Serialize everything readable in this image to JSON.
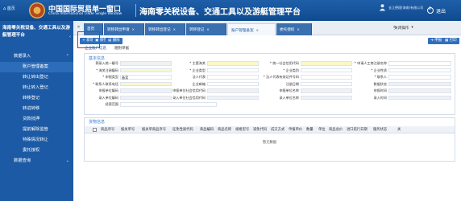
{
  "header": {
    "home_label": "首页",
    "brand_cn": "中国国际贸易单一窗口",
    "brand_en": "China International Trade Single Window",
    "title": "海南零关税设备、交通工具以及游艇管理平台",
    "user_text": "长江德理(海南)有限公司",
    "logout_label": "退出"
  },
  "sidebar": {
    "title": "海南零关税设备、交通工具以及游艇管理平台",
    "collapse_icon": "chevron-left-icon",
    "groups": [
      {
        "label": "数据录入",
        "expanded": true
      },
      {
        "label": "数据查询",
        "expanded": false
      }
    ],
    "items": [
      {
        "label": "账户管理备案",
        "active": true
      },
      {
        "label": "转让转出登记",
        "active": false
      },
      {
        "label": "转让转入登记",
        "active": false
      },
      {
        "label": "转移登记",
        "active": false
      },
      {
        "label": "转进转移",
        "active": false
      },
      {
        "label": "贷款抵押",
        "active": false
      },
      {
        "label": "提前解除监管",
        "active": false
      },
      {
        "label": "特殊情况转让",
        "active": false
      },
      {
        "label": "委托授权",
        "active": false
      }
    ]
  },
  "tabs": {
    "items": [
      {
        "label": "首页",
        "active": false
      },
      {
        "label": "转移转出申请",
        "active": false
      },
      {
        "label": "转移转出登记",
        "active": false
      },
      {
        "label": "转移登记",
        "active": false
      },
      {
        "label": "账户管理备案",
        "active": true
      },
      {
        "label": "委托授权",
        "active": false
      }
    ],
    "close_label": "关闭操作"
  },
  "toolbar": {
    "new_label": "新增",
    "save_label": "保存",
    "delete_label": "删除",
    "declare_label": "申报",
    "print_label": "打印"
  },
  "subtabs": [
    "企业账户信息",
    "随附单据"
  ],
  "basic_info": {
    "section_title": "基本信息",
    "rows": [
      [
        {
          "label": "预录入统一编号",
          "value": "",
          "tone": "gray"
        },
        {
          "label": "* 主管海关",
          "value": "",
          "tone": "yellow"
        },
        {
          "label": "* 统一社会信用代码",
          "value": "",
          "tone": "yellow"
        },
        {
          "label": "* 申请人工商注册名称",
          "value": "",
          "tone": "white"
        }
      ],
      [
        {
          "label": "* 海关注册编码",
          "value": "",
          "tone": "yellow"
        },
        {
          "label": "* 企业类型",
          "value": "",
          "tone": "white"
        },
        {
          "label": "* 企业类别",
          "value": "",
          "tone": "white"
        },
        {
          "label": "* 企业性质",
          "value": "",
          "tone": "white"
        }
      ],
      [
        {
          "label": "* 申报类型",
          "value": "备案",
          "tone": "white"
        },
        {
          "label": "法人代表",
          "value": "",
          "tone": "white"
        },
        {
          "label": "* 法人代表有效证件号码",
          "value": "",
          "tone": "white"
        },
        {
          "label": "* 联系人",
          "value": "",
          "tone": "white"
        }
      ],
      [
        {
          "label": "* 联系人联系电话",
          "value": "",
          "tone": "yellow"
        },
        {
          "label": "企业邮箱",
          "value": "",
          "tone": "white"
        },
        {
          "label": "注册日期",
          "value": "",
          "tone": "white"
        },
        {
          "label": "数据状态",
          "value": "",
          "tone": "gray"
        }
      ],
      [
        {
          "label": "申报单位编码",
          "value": "",
          "tone": "gray"
        },
        {
          "label": "申报单位社会信用代码",
          "value": "",
          "tone": "gray"
        },
        {
          "label": "申报单位名称",
          "value": "",
          "tone": "gray"
        },
        {
          "label": "申报时间",
          "value": "",
          "tone": "gray"
        }
      ],
      [
        {
          "label": "录入单位编码",
          "value": "",
          "tone": "gray"
        },
        {
          "label": "录入单位社会信用代码",
          "value": "",
          "tone": "gray"
        },
        {
          "label": "录入单位名称",
          "value": "",
          "tone": "gray"
        },
        {
          "label": "录入时间",
          "value": "",
          "tone": "gray"
        }
      ],
      [
        {
          "label": "经营范围",
          "value": "",
          "tone": "white"
        }
      ]
    ]
  },
  "list": {
    "section_title": "货物信息",
    "columns": [
      "商品序号",
      "报关单号",
      "报关单商品序号",
      "征免性质代码",
      "商品编码",
      "商品名称",
      "规格型号",
      "减免代码",
      "成交方式",
      "申报单价",
      "数量",
      "单位",
      "商品总价",
      "进口航行日期",
      "服务状态",
      "关"
    ],
    "empty_text": "暂无数据"
  }
}
